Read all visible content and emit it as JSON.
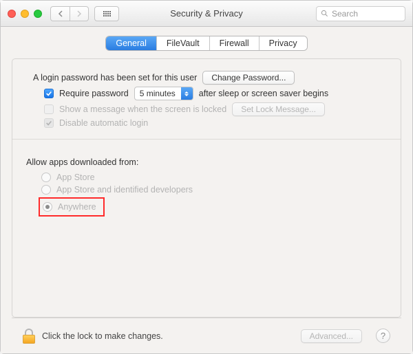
{
  "window": {
    "title": "Security & Privacy"
  },
  "search": {
    "placeholder": "Search"
  },
  "tabs": [
    {
      "label": "General"
    },
    {
      "label": "FileVault"
    },
    {
      "label": "Firewall"
    },
    {
      "label": "Privacy"
    }
  ],
  "login": {
    "status_text": "A login password has been set for this user",
    "change_password_btn": "Change Password...",
    "require_password_label": "Require password",
    "delay_value": "5 minutes",
    "after_text": "after sleep or screen saver begins",
    "show_message_label": "Show a message when the screen is locked",
    "set_lock_message_btn": "Set Lock Message...",
    "disable_auto_login_label": "Disable automatic login"
  },
  "allow_apps": {
    "title": "Allow apps downloaded from:",
    "options": [
      {
        "label": "App Store"
      },
      {
        "label": "App Store and identified developers"
      },
      {
        "label": "Anywhere"
      }
    ]
  },
  "footer": {
    "lock_text": "Click the lock to make changes.",
    "advanced_btn": "Advanced..."
  }
}
